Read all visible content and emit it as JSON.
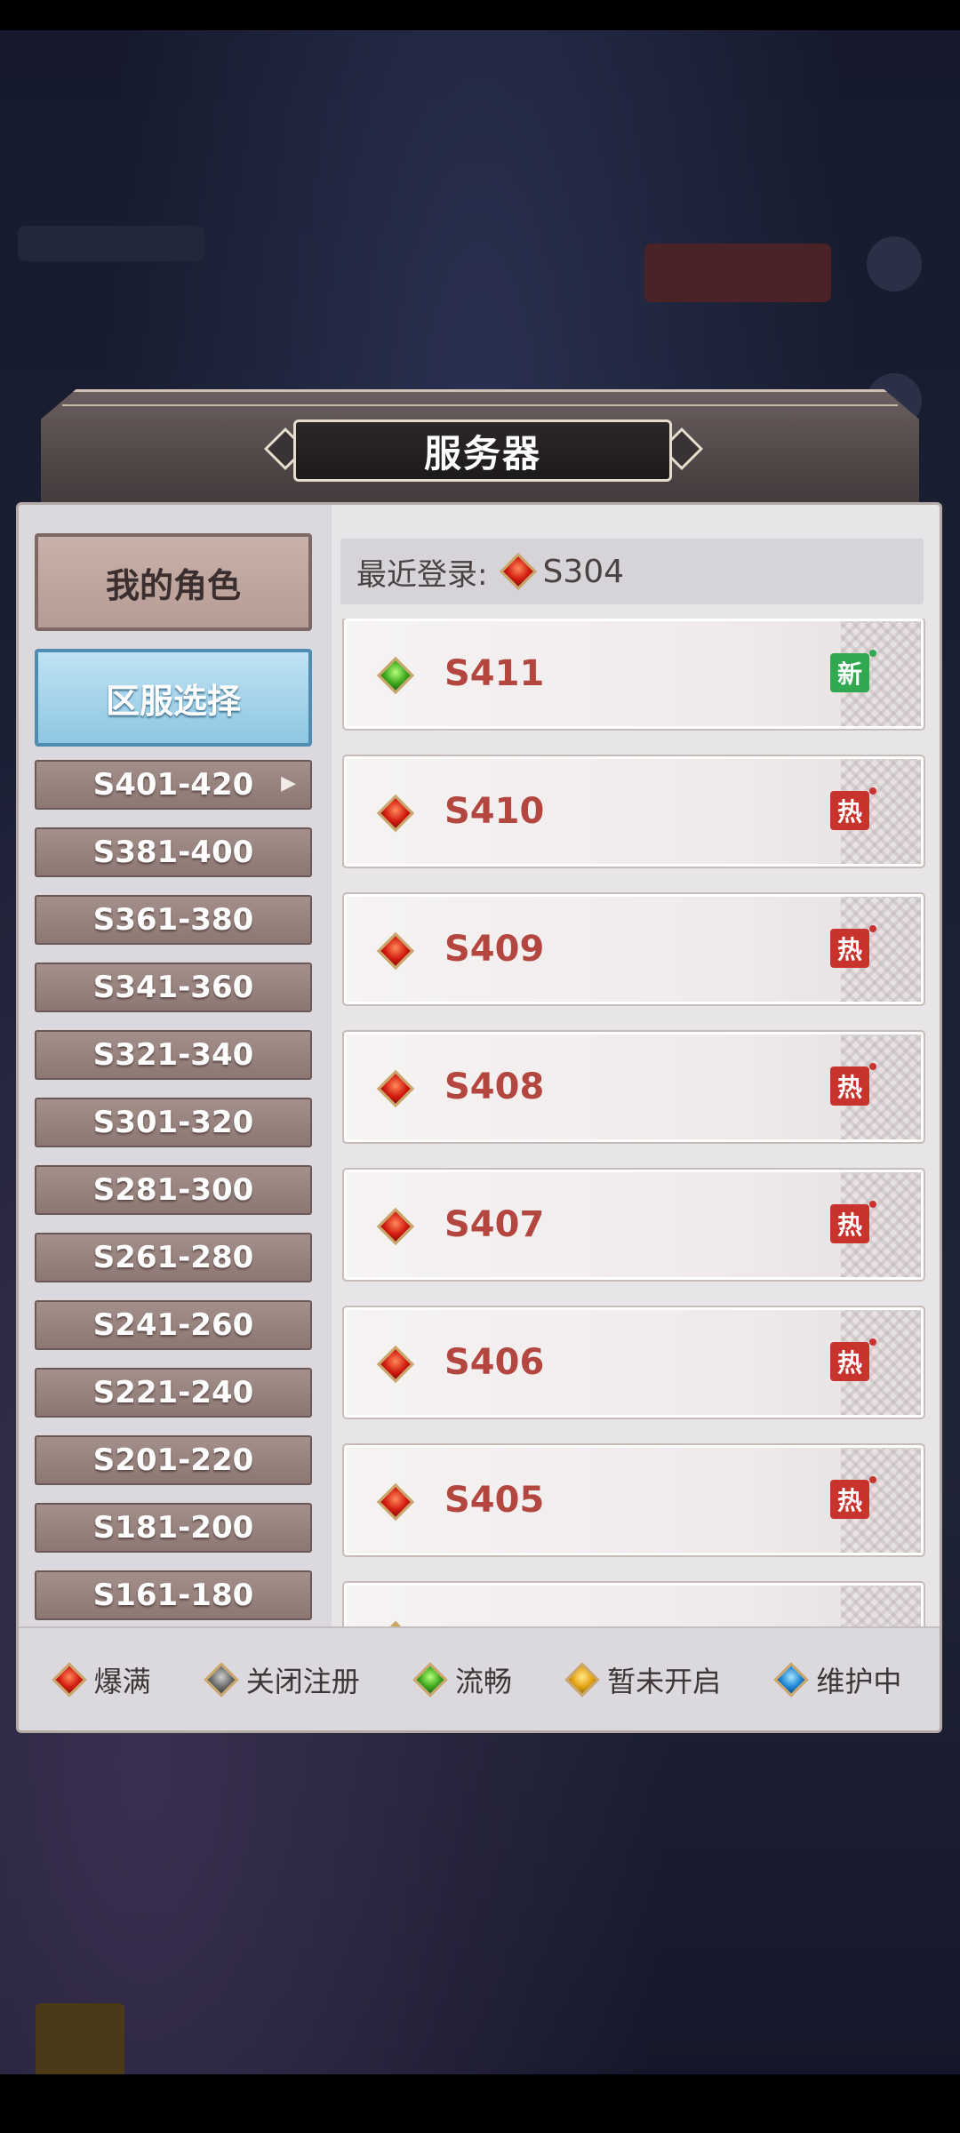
{
  "dialog": {
    "title": "服务器"
  },
  "sidebar": {
    "tabs": [
      {
        "label": "我的角色"
      },
      {
        "label": "区服选择"
      }
    ],
    "ranges": [
      "S401-420",
      "S381-400",
      "S361-380",
      "S341-360",
      "S321-340",
      "S301-320",
      "S281-300",
      "S261-280",
      "S241-260",
      "S221-240",
      "S201-220",
      "S181-200",
      "S161-180"
    ]
  },
  "recent": {
    "label": "最近登录:",
    "server": "S304",
    "gem": "red"
  },
  "servers": [
    {
      "name": "S411",
      "gem": "green",
      "badge": "新"
    },
    {
      "name": "S410",
      "gem": "red",
      "badge": "热"
    },
    {
      "name": "S409",
      "gem": "red",
      "badge": "热"
    },
    {
      "name": "S408",
      "gem": "red",
      "badge": "热"
    },
    {
      "name": "S407",
      "gem": "red",
      "badge": "热"
    },
    {
      "name": "S406",
      "gem": "red",
      "badge": "热"
    },
    {
      "name": "S405",
      "gem": "red",
      "badge": "热"
    },
    {
      "name": "",
      "gem": "yellow",
      "badge": ""
    }
  ],
  "legend": [
    {
      "label": "爆满",
      "gem": "red"
    },
    {
      "label": "关闭注册",
      "gem": "grey"
    },
    {
      "label": "流畅",
      "gem": "green"
    },
    {
      "label": "暂未开启",
      "gem": "yellow"
    },
    {
      "label": "维护中",
      "gem": "blue"
    }
  ],
  "colors": {
    "server_name": "#b3463f",
    "badge_new": "#2fa84f",
    "badge_hot": "#c8332d",
    "tab_selected": "#8fc6e2"
  }
}
